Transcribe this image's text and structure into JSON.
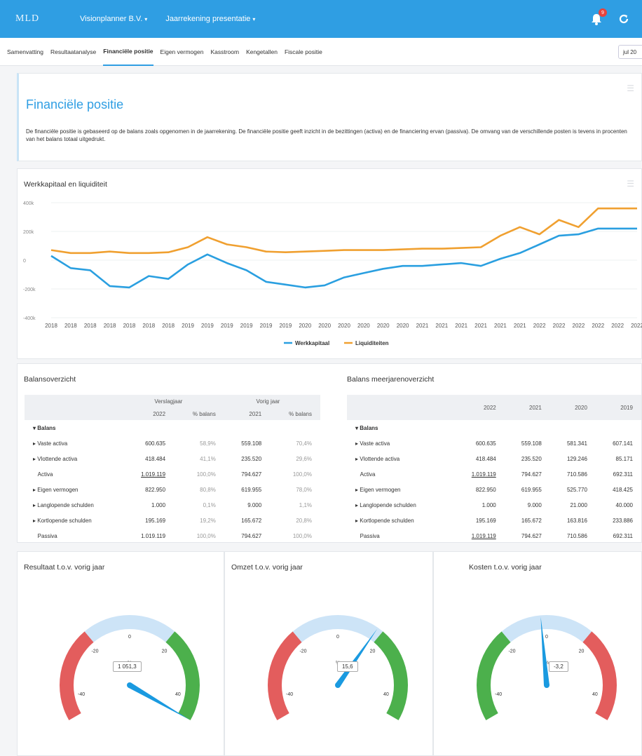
{
  "header": {
    "logo": "MLD",
    "company": "Visionplanner B.V.",
    "report": "Jaarrekening presentatie",
    "notification_count": "9"
  },
  "tabs": [
    "Samenvatting",
    "Resultaatanalyse",
    "Financiële positie",
    "Eigen vermogen",
    "Kasstroom",
    "Kengetallen",
    "Fiscale positie"
  ],
  "period": "jul 20",
  "intro": {
    "title": "Financiële positie",
    "text": "De financiële positie is gebaseerd op de balans zoals opgenomen in de jaarrekening. De financiële positie geeft inzicht in de bezittingen (activa) en de financiering ervan (passiva). De omvang van de verschillende posten is tevens in procenten van het balans totaal uitgedrukt."
  },
  "chart_data": {
    "type": "line",
    "title": "Werkkapitaal en liquiditeit",
    "ylim": [
      -400000,
      400000
    ],
    "yticks": [
      "400k",
      "200k",
      "0",
      "-200k",
      "-400k"
    ],
    "x": [
      "2018",
      "2018",
      "2018",
      "2018",
      "2018",
      "2018",
      "2018",
      "2019",
      "2019",
      "2019",
      "2019",
      "2019",
      "2019",
      "2020",
      "2020",
      "2020",
      "2020",
      "2020",
      "2020",
      "2021",
      "2021",
      "2021",
      "2021",
      "2021",
      "2021",
      "2022",
      "2022",
      "2022",
      "2022",
      "2022",
      "2022"
    ],
    "series": [
      {
        "name": "Werkkapitaal",
        "color": "#2a9fe0",
        "values": [
          30000,
          -55000,
          -70000,
          -180000,
          -190000,
          -110000,
          -130000,
          -30000,
          40000,
          -20000,
          -70000,
          -150000,
          -170000,
          -190000,
          -175000,
          -120000,
          -90000,
          -60000,
          -40000,
          -40000,
          -30000,
          -20000,
          -40000,
          10000,
          50000,
          110000,
          170000,
          180000,
          220000,
          220000,
          220000
        ]
      },
      {
        "name": "Liquiditeiten",
        "color": "#f0a030",
        "values": [
          70000,
          50000,
          50000,
          60000,
          50000,
          50000,
          55000,
          90000,
          160000,
          110000,
          90000,
          60000,
          55000,
          60000,
          65000,
          70000,
          70000,
          70000,
          75000,
          80000,
          80000,
          85000,
          90000,
          170000,
          230000,
          180000,
          280000,
          230000,
          360000,
          360000,
          360000
        ]
      }
    ],
    "legend": "bottom"
  },
  "balans": {
    "title": "Balansoverzicht",
    "group_headers": [
      "Verslagjaar",
      "Vorig jaar"
    ],
    "headers": [
      "2022",
      "% balans",
      "2021",
      "% balans"
    ],
    "section": "Balans",
    "rows": [
      {
        "label": "Vaste activa",
        "v1": "600.635",
        "p1": "58,9%",
        "v2": "559.108",
        "p2": "70,4%",
        "expand": true
      },
      {
        "label": "Vlottende activa",
        "v1": "418.484",
        "p1": "41,1%",
        "v2": "235.520",
        "p2": "29,6%",
        "expand": true
      },
      {
        "label": "Activa",
        "v1": "1.019.119",
        "p1": "100,0%",
        "v2": "794.627",
        "p2": "100,0%",
        "expand": false
      },
      {
        "label": "Eigen vermogen",
        "v1": "822.950",
        "p1": "80,8%",
        "v2": "619.955",
        "p2": "78,0%",
        "expand": true
      },
      {
        "label": "Langlopende schulden",
        "v1": "1.000",
        "p1": "0,1%",
        "v2": "9.000",
        "p2": "1,1%",
        "expand": true
      },
      {
        "label": "Kortlopende schulden",
        "v1": "195.169",
        "p1": "19,2%",
        "v2": "165.672",
        "p2": "20,8%",
        "expand": true
      },
      {
        "label": "Passiva",
        "v1": "1.019.119",
        "p1": "100,0%",
        "v2": "794.627",
        "p2": "100,0%",
        "expand": false
      }
    ]
  },
  "meerjaren": {
    "title": "Balans meerjarenoverzicht",
    "headers": [
      "2022",
      "2021",
      "2020",
      "2019"
    ],
    "section": "Balans",
    "rows": [
      {
        "label": "Vaste activa",
        "vals": [
          "600.635",
          "559.108",
          "581.341",
          "607.141"
        ],
        "expand": true
      },
      {
        "label": "Vlottende activa",
        "vals": [
          "418.484",
          "235.520",
          "129.246",
          "85.171"
        ],
        "expand": true
      },
      {
        "label": "Activa",
        "vals": [
          "1.019.119",
          "794.627",
          "710.586",
          "692.311"
        ],
        "expand": false
      },
      {
        "label": "Eigen vermogen",
        "vals": [
          "822.950",
          "619.955",
          "525.770",
          "418.425"
        ],
        "expand": true
      },
      {
        "label": "Langlopende schulden",
        "vals": [
          "1.000",
          "9.000",
          "21.000",
          "40.000"
        ],
        "expand": true
      },
      {
        "label": "Kortlopende schulden",
        "vals": [
          "195.169",
          "165.672",
          "163.816",
          "233.886"
        ],
        "expand": true
      },
      {
        "label": "Passiva",
        "vals": [
          "1.019.119",
          "794.627",
          "710.586",
          "692.311"
        ],
        "expand": false
      }
    ]
  },
  "gauges": [
    {
      "title": "Resultaat t.o.v. vorig jaar",
      "value": "1 051,3",
      "angle": 120,
      "mode": "normal",
      "unit": "%",
      "ticks": [
        "-40",
        "-20",
        "0",
        "20",
        "40"
      ]
    },
    {
      "title": "Omzet t.o.v. vorig jaar",
      "value": "15,6",
      "angle": 35,
      "mode": "normal",
      "unit": "%",
      "ticks": [
        "-40",
        "-20",
        "0",
        "20",
        "40"
      ]
    },
    {
      "title": "Kosten t.o.v. vorig jaar",
      "value": "-3,2",
      "angle": -5,
      "mode": "reverse",
      "unit": "%",
      "ticks": [
        "-40",
        "-20",
        "0",
        "20",
        "40"
      ]
    }
  ]
}
